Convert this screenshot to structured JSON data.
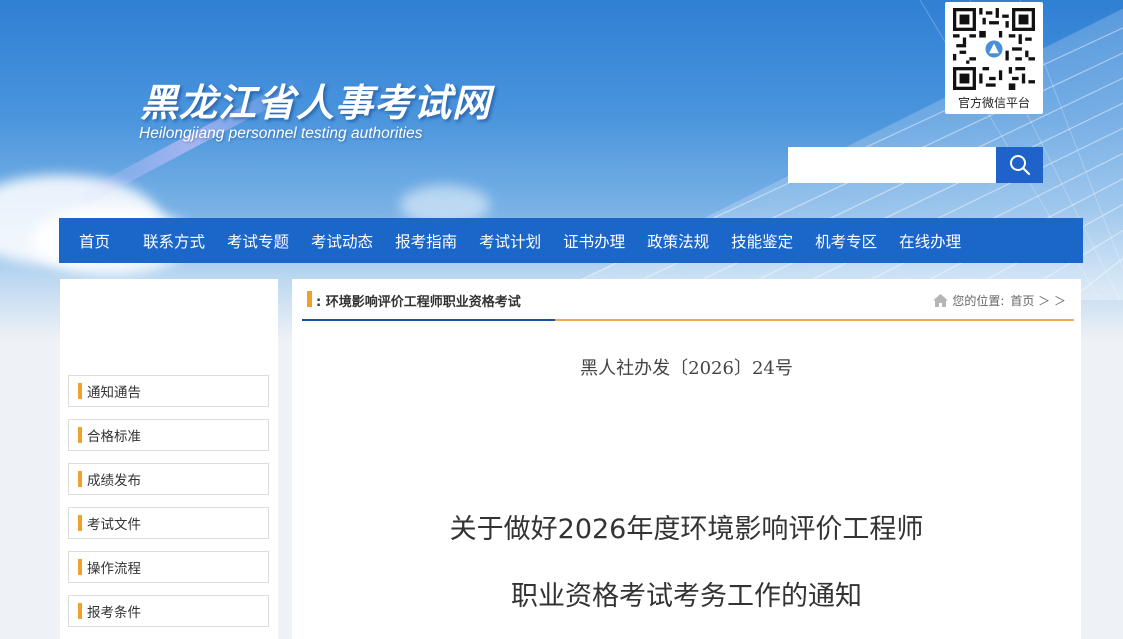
{
  "header": {
    "title": "黑龙江省人事考试网",
    "subtitle": "Heilongjiang personnel testing authorities",
    "qr_caption": "官方微信平台",
    "search": {
      "placeholder": ""
    }
  },
  "nav": {
    "items": [
      "首页",
      "联系方式",
      "考试专题",
      "考试动态",
      "报考指南",
      "考试计划",
      "证书办理",
      "政策法规",
      "技能鉴定",
      "机考专区",
      "在线办理"
    ]
  },
  "sidebar": {
    "items": [
      "通知通告",
      "合格标准",
      "成绩发布",
      "考试文件",
      "操作流程",
      "报考条件"
    ]
  },
  "main": {
    "section_title": ": 环境影响评价工程师职业资格考试",
    "location_label": "您的位置:",
    "location_path": "首页 ＞ ＞",
    "doc_number": "黑人社办发〔2026〕24号",
    "doc_title_line1": "关于做好2026年度环境影响评价工程师",
    "doc_title_line2": "职业资格考试考务工作的通知"
  },
  "colors": {
    "nav_bg": "#1b66c9",
    "search_button": "#1f62c9",
    "accent_orange": "#f0a02c",
    "section_underline_blue": "#1b4fa0",
    "section_underline_orange": "#f2a65a"
  },
  "icons": [
    "search-icon",
    "home-icon",
    "qr-code"
  ]
}
